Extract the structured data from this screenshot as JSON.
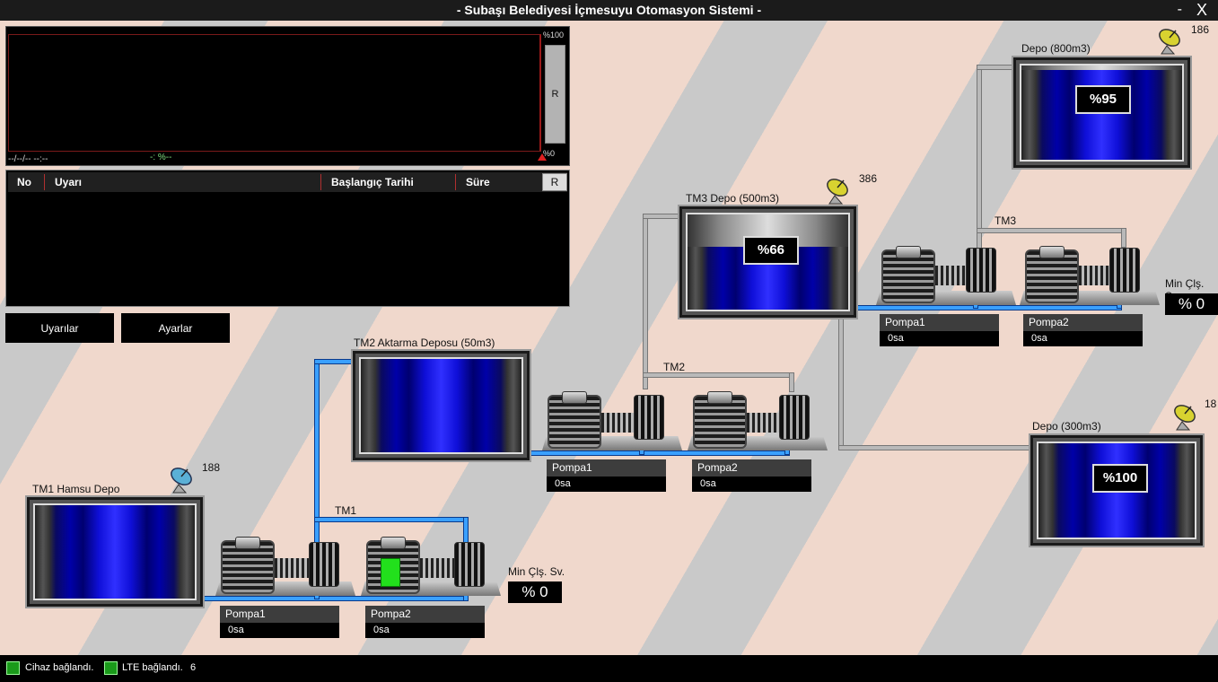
{
  "window": {
    "title": "- Subaşı Belediyesi İçmesuyu Otomasyon Sistemi -",
    "minimize": "-",
    "close": "X"
  },
  "chart": {
    "top_label": "%100",
    "bottom_label": "%0",
    "reset_label": "R",
    "date_label": "--/--/-- --:--",
    "value_label": "-: %--"
  },
  "alarms": {
    "columns": [
      "No",
      "Uyarı",
      "Başlangıç Tarihi",
      "Süre"
    ],
    "reset_label": "R",
    "rows": []
  },
  "buttons": {
    "warnings": "Uyarılar",
    "settings": "Ayarlar"
  },
  "tanks": {
    "tm1": {
      "label": "TM1 Hamsu Depo",
      "antenna_count": "188"
    },
    "tm2": {
      "label": "TM2 Aktarma Deposu (50m3)"
    },
    "tm3": {
      "label": "TM3 Depo (500m3)",
      "level": "%66",
      "level_value": 66,
      "antenna_count": "386"
    },
    "depo800": {
      "label": "Depo (800m3)",
      "level": "%95",
      "level_value": 95,
      "antenna_count": "186"
    },
    "depo300": {
      "label": "Depo (300m3)",
      "level": "%100",
      "level_value": 100,
      "antenna_count": "18"
    }
  },
  "stations": {
    "tm1": {
      "label": "TM1",
      "min_label": "Min Çlş. Sv.",
      "min_value": "% 0",
      "pumps": [
        {
          "name": "Pompa1",
          "time": "0sa",
          "running": false
        },
        {
          "name": "Pompa2",
          "time": "0sa",
          "running": true
        }
      ]
    },
    "tm2": {
      "label": "TM2",
      "pumps": [
        {
          "name": "Pompa1",
          "time": "0sa",
          "running": false
        },
        {
          "name": "Pompa2",
          "time": "0sa",
          "running": false
        }
      ]
    },
    "tm3": {
      "label": "TM3",
      "min_label": "Min Çlş. Sv.",
      "min_value": "% 0",
      "pumps": [
        {
          "name": "Pompa1",
          "time": "0sa",
          "running": false
        },
        {
          "name": "Pompa2",
          "time": "0sa",
          "running": false
        }
      ]
    }
  },
  "status": {
    "device": "Cihaz bağlandı.",
    "lte": "LTE bağlandı.",
    "signal": "6"
  },
  "colors": {
    "water": "#0000a8",
    "pipe_active": "#3aa0ff",
    "pipe_idle": "#b9b9b9",
    "pump_running": "#22e01c",
    "status_ok": "#1a9a1a"
  }
}
